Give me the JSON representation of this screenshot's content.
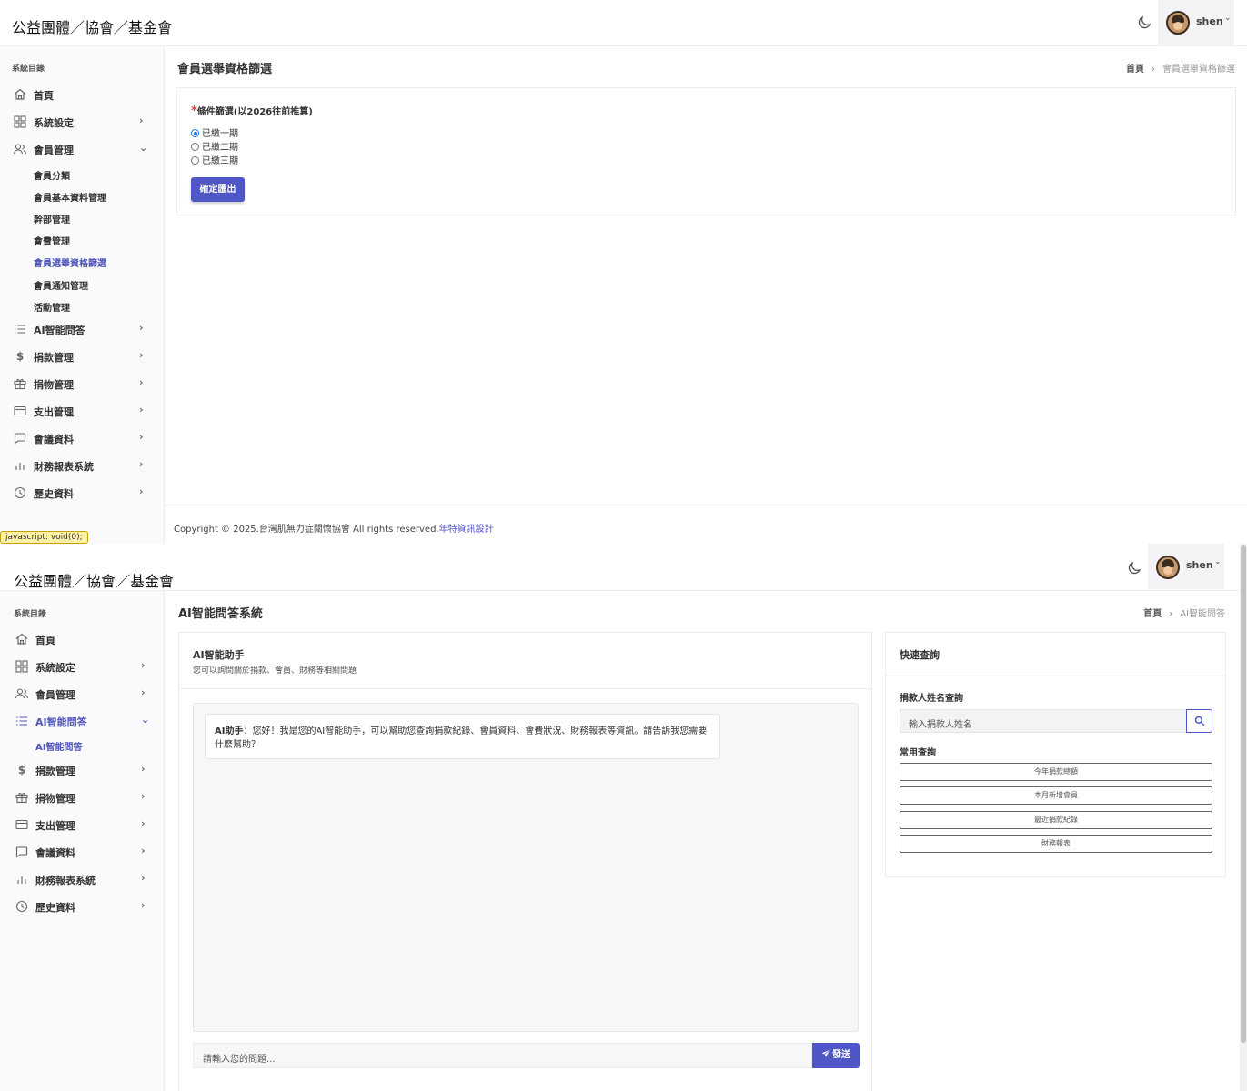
{
  "brand": "公益團體／協會／基金會",
  "user": {
    "name": "shen"
  },
  "sidebar": {
    "title": "系統目錄"
  },
  "screen1": {
    "nav": [
      {
        "label": "首頁",
        "icon": "home-icon"
      },
      {
        "label": "系統設定",
        "icon": "grid-icon"
      },
      {
        "label": "會員管理",
        "icon": "users-icon"
      },
      {
        "label": "AI智能問答",
        "icon": "list-icon"
      },
      {
        "label": "捐款管理",
        "icon": "dollar-icon"
      },
      {
        "label": "捐物管理",
        "icon": "gift-icon"
      },
      {
        "label": "支出管理",
        "icon": "card-icon"
      },
      {
        "label": "會議資料",
        "icon": "chat-icon"
      },
      {
        "label": "財務報表系統",
        "icon": "bar-chart-icon"
      },
      {
        "label": "歷史資料",
        "icon": "clock-icon"
      }
    ],
    "submenu": [
      "會員分類",
      "會員基本資料管理",
      "幹部管理",
      "會費管理",
      "會員選舉資格篩選",
      "會員通知管理",
      "活動管理"
    ],
    "page_title": "會員選舉資格篩選",
    "breadcrumb": {
      "home": "首頁",
      "current": "會員選舉資格篩選"
    },
    "form": {
      "required_mark": "*",
      "label": "條件篩選(以2026往前推算)",
      "options": [
        {
          "label": "已繳一期",
          "checked": true
        },
        {
          "label": "已繳二期",
          "checked": false
        },
        {
          "label": "已繳三期",
          "checked": false
        }
      ],
      "submit": "確定匯出"
    },
    "footer": {
      "text": "Copyright © 2025.台灣肌無力症關懷協會 All rights reserved.",
      "link": "年特資訊設計"
    },
    "status_tooltip": "javascript: void(0);"
  },
  "screen2": {
    "nav": [
      {
        "label": "首頁",
        "icon": "home-icon"
      },
      {
        "label": "系統設定",
        "icon": "grid-icon"
      },
      {
        "label": "會員管理",
        "icon": "users-icon"
      },
      {
        "label": "AI智能問答",
        "icon": "list-icon"
      },
      {
        "label": "捐款管理",
        "icon": "dollar-icon"
      },
      {
        "label": "捐物管理",
        "icon": "gift-icon"
      },
      {
        "label": "支出管理",
        "icon": "card-icon"
      },
      {
        "label": "會議資料",
        "icon": "chat-icon"
      },
      {
        "label": "財務報表系統",
        "icon": "bar-chart-icon"
      },
      {
        "label": "歷史資料",
        "icon": "clock-icon"
      }
    ],
    "submenu": [
      "AI智能問答"
    ],
    "page_title": "AI智能問答系統",
    "breadcrumb": {
      "home": "首頁",
      "current": "AI智能問答"
    },
    "assistant": {
      "title": "AI智能助手",
      "subtitle": "您可以詢問關於捐款、會員、財務等相關問題",
      "message_sender": "AI助手",
      "message_text": "：您好！我是您的AI智能助手，可以幫助您查詢捐款紀錄、會員資料、會費狀況、財務報表等資訊。請告訴我您需要什麼幫助？",
      "input_placeholder": "請輸入您的問題...",
      "send": "發送"
    },
    "quick": {
      "title": "快速查詢",
      "donor_label": "捐款人姓名查詢",
      "donor_placeholder": "輸入捐款人姓名",
      "common_label": "常用查詢",
      "buttons": [
        "今年捐款總額",
        "本月新增會員",
        "最近捐款紀錄",
        "財務報表"
      ]
    }
  }
}
